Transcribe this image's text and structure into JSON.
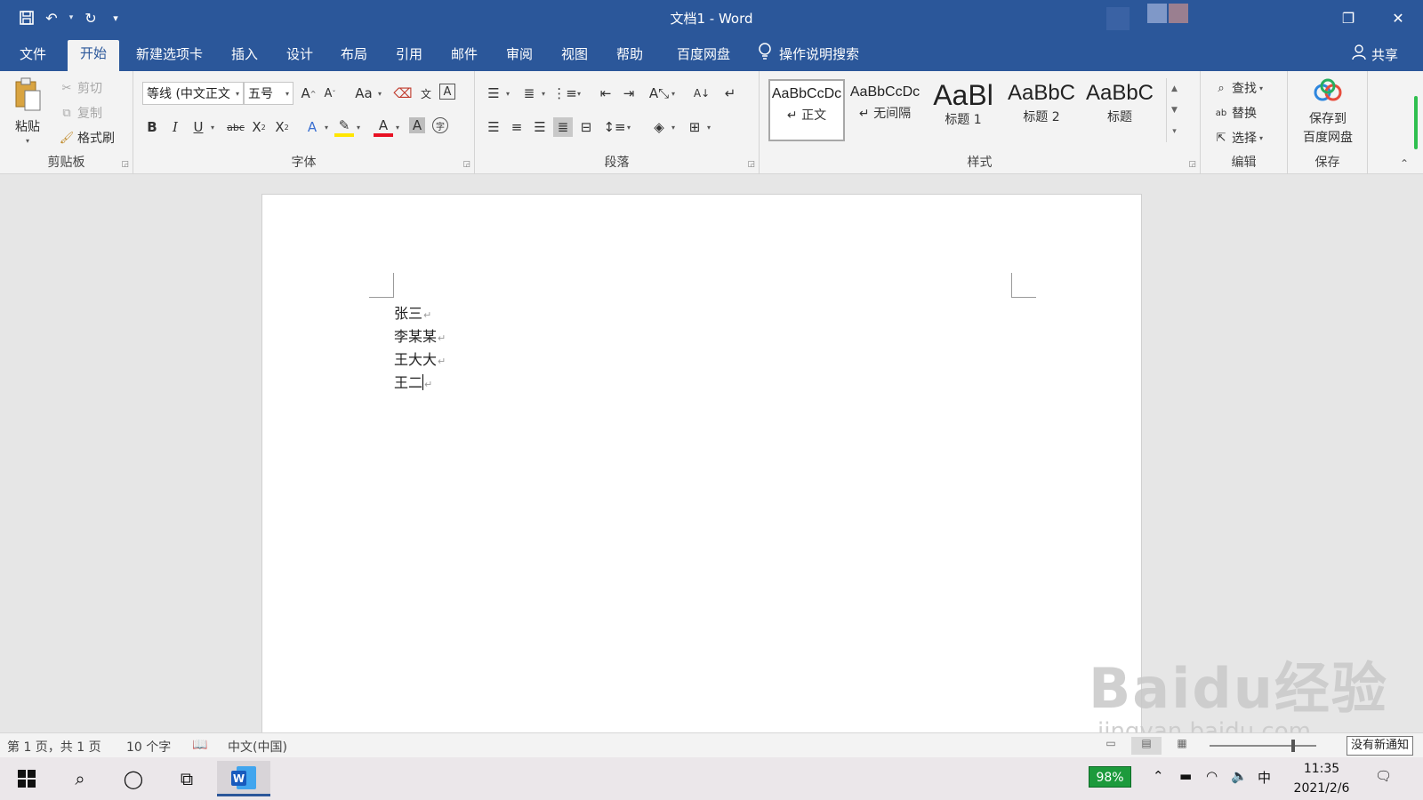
{
  "window": {
    "title": "文档1  -  Word",
    "controls": {
      "restore": "❐",
      "close": "✕"
    }
  },
  "quick_access": {
    "save": "💾",
    "undo": "↶",
    "redo": "↻",
    "customize": "▾"
  },
  "tabs": [
    "文件",
    "开始",
    "新建选项卡",
    "插入",
    "设计",
    "布局",
    "引用",
    "邮件",
    "审阅",
    "视图",
    "帮助",
    "百度网盘"
  ],
  "active_tab": "开始",
  "tell_me": "操作说明搜索",
  "share": "共享",
  "ribbon": {
    "clipboard": {
      "label": "剪贴板",
      "paste": "粘贴",
      "cut": "剪切",
      "copy": "复制",
      "format_painter": "格式刷"
    },
    "font": {
      "label": "字体",
      "font_name": "等线 (中文正文",
      "font_size": "五号",
      "change_case": "Aa"
    },
    "paragraph": {
      "label": "段落"
    },
    "styles": {
      "label": "样式",
      "items": [
        {
          "sample": "AaBbCcDc",
          "name": "↵ 正文"
        },
        {
          "sample": "AaBbCcDc",
          "name": "↵ 无间隔"
        },
        {
          "sample": "AaBl",
          "name": "标题 1"
        },
        {
          "sample": "AaBbC",
          "name": "标题 2"
        },
        {
          "sample": "AaBbC",
          "name": "标题"
        }
      ]
    },
    "editing": {
      "label": "编辑",
      "find": "查找",
      "replace": "替换",
      "select": "选择"
    },
    "save": {
      "label": "保存",
      "button_line1": "保存到",
      "button_line2": "百度网盘"
    }
  },
  "document": {
    "paragraphs": [
      "张三",
      "李某某",
      "王大大",
      "王二"
    ],
    "paragraph_mark": "↵"
  },
  "status": {
    "page": "第 1 页，共 1 页",
    "words": "10 个字",
    "language": "中文(中国)",
    "notification_tooltip": "没有新通知"
  },
  "taskbar": {
    "battery_percent": "98%",
    "ime": "中",
    "time": "11:35",
    "date": "2021/2/6"
  },
  "watermark": {
    "main": "Baidu经验",
    "sub": "jingyan.baidu.com"
  }
}
